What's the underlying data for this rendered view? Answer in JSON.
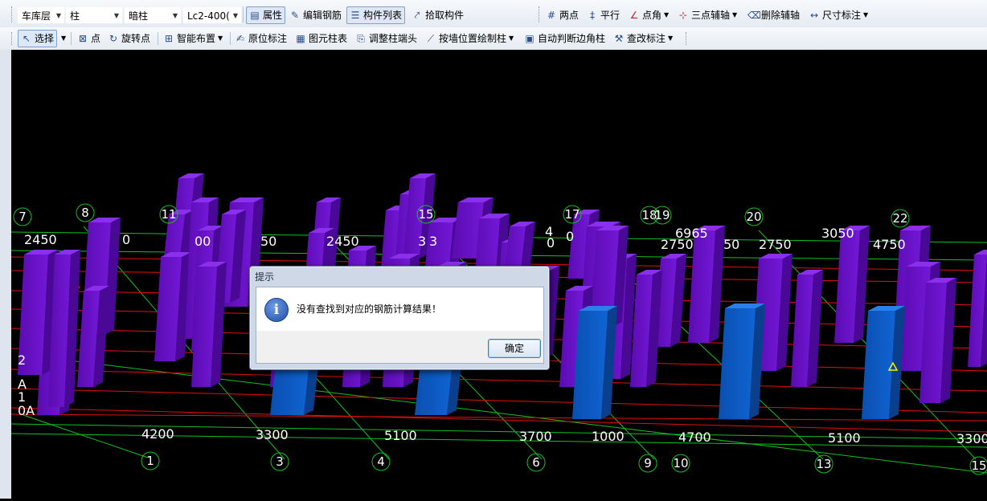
{
  "toolbar1": {
    "floor": "车库层",
    "element_type": "柱",
    "subtype": "暗柱",
    "component": "Lc2-400(",
    "btn_properties": "属性",
    "btn_edit_rebar": "编辑钢筋",
    "btn_component_list": "构件列表",
    "btn_pick": "拾取构件",
    "btn_two_points": "两点",
    "btn_parallel": "平行",
    "btn_point_angle": "点角",
    "btn_three_point_axis": "三点辅轴",
    "btn_delete_axis": "删除辅轴",
    "btn_dimension": "尺寸标注"
  },
  "toolbar2": {
    "btn_select": "选择",
    "btn_point": "点",
    "btn_rotate_point": "旋转点",
    "btn_smart_place": "智能布置",
    "btn_in_place_label": "原位标注",
    "btn_column_table": "图元柱表",
    "btn_adjust_column_end": "调整柱端头",
    "btn_draw_by_wall": "按墙位置绘制柱",
    "btn_auto_edge_corner": "自动判断边角柱",
    "btn_edit_label": "查改标注"
  },
  "viewport": {
    "axis_top": [
      "7",
      "8",
      "11",
      "15",
      "17",
      "18",
      "19",
      "20",
      "22"
    ],
    "axis_bottom": [
      "1",
      "3",
      "4",
      "6",
      "9",
      "10",
      "13",
      "15"
    ],
    "axis_left": [
      "2",
      "A",
      "1",
      "0A"
    ],
    "dims_top": [
      "2450",
      "0",
      "00",
      "50",
      "2450",
      "3",
      "3",
      "4",
      "0",
      "0",
      "6965",
      "2750",
      "50",
      "2750",
      "3050",
      "4750"
    ],
    "dims_bottom": [
      "4200",
      "3300",
      "5100",
      "3700",
      "1000",
      "4700",
      "5100",
      "3300"
    ],
    "colors": {
      "column": "#6a10c8",
      "column_selected": "#0b5cc4",
      "red_grid": "#e01010",
      "green_grid": "#10c020"
    }
  },
  "dialog": {
    "title": "提示",
    "message": "没有查找到对应的钢筋计算结果！",
    "ok": "确定"
  }
}
